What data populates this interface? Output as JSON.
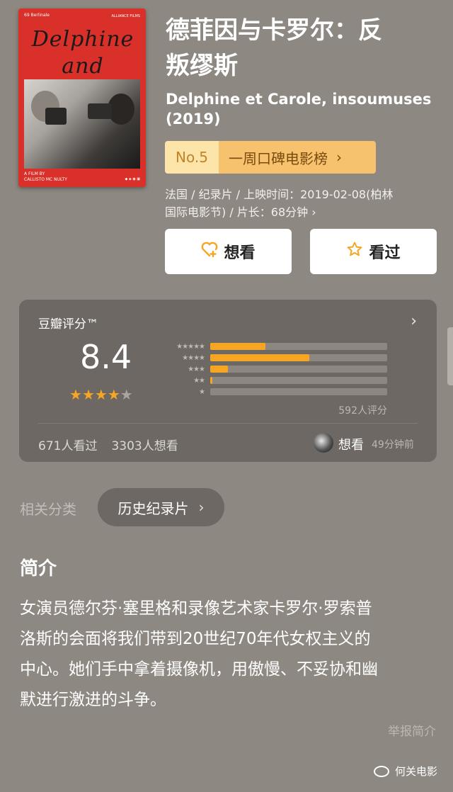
{
  "poster": {
    "script_line1": "Delphine",
    "script_line2": "and Carole",
    "festival": "69 Berlinale",
    "top_right": "ALLIANCE FILMS",
    "credit_line1": "A FILM BY",
    "credit_line2": "CALLISTO MC NULTY",
    "logos": "◆ ◈ ◉ ▣"
  },
  "movie": {
    "title_line1": "德菲因与卡罗尔：反",
    "title_line2": "叛缪斯",
    "original_title": "Delphine et Carole, insoumuses",
    "year": "(2019)"
  },
  "rank": {
    "number": "No.5",
    "list_name": "一周口碑电影榜",
    "chevron": "›"
  },
  "meta": {
    "line1": "法国 / 纪录片 / 上映时间：2019-02-08(柏林",
    "line2": "国际电影节) / 片长：68分钟 ›"
  },
  "actions": {
    "want_label": "想看",
    "want_icon": "heart-plus-icon",
    "seen_label": "看过",
    "seen_icon": "star-outline-icon"
  },
  "rating": {
    "label": "豆瓣评分™",
    "score": "8.4",
    "stars": 4,
    "star_max": 5,
    "distribution": [
      {
        "stars": "★★★★★",
        "fraction": 0.31
      },
      {
        "stars": "★★★★",
        "fraction": 0.56
      },
      {
        "stars": "★★★",
        "fraction": 0.1
      },
      {
        "stars": "★★",
        "fraction": 0.01
      },
      {
        "stars": "★",
        "fraction": 0.0
      }
    ],
    "count": "592人评分",
    "seen_count": "671人看过",
    "want_count": "3303人想看",
    "friend_action": "想看",
    "friend_time": "49分钟前",
    "accent": "#f6a623"
  },
  "category": {
    "label": "相关分类",
    "chip": "历史纪录片"
  },
  "synopsis": {
    "title": "简介",
    "line1": "女演员德尔芬·塞里格和录像艺术家卡罗尔·罗索普",
    "line2": "洛斯的会面将我们带到20世纪70年代女权主义的",
    "line3": "中心。她们手中拿着摄像机，用傲慢、不妥协和幽",
    "line4": "默进行激进的斗争。",
    "report": "举报简介"
  },
  "watermark": {
    "text": "何关电影"
  }
}
